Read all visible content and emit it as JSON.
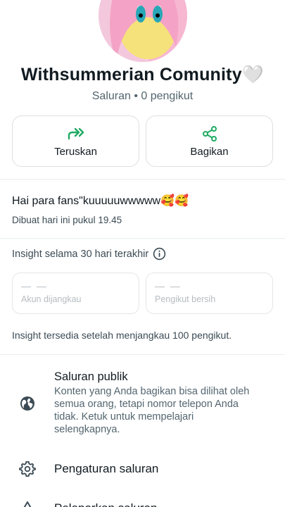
{
  "channel": {
    "name": "Withsummerian Comunity",
    "name_suffix": "🤍",
    "meta": "Saluran • 0 pengikut"
  },
  "actions": {
    "forward_label": "Teruskan",
    "share_label": "Bagikan"
  },
  "description": {
    "text": "Hai para fans\"kuuuuuwwwww🥰🥰",
    "created": "Dibuat hari ini pukul 19.45"
  },
  "insights": {
    "title": "Insight selama 30 hari terakhir",
    "reach": {
      "value": "— —",
      "label": "Akun dijangkau"
    },
    "net_followers": {
      "value": "— —",
      "label": "Pengikut bersih"
    },
    "note": "Insight tersedia setelah menjangkau 100 pengikut."
  },
  "settings": {
    "public_title": "Saluran publik",
    "public_desc": "Konten yang Anda bagikan bisa dilihat oleh semua orang, tetapi nomor telepon Anda tidak. Ketuk untuk mempelajari selengkapnya.",
    "channel_settings": "Pengaturan saluran",
    "next_item_partial": "Pelaporkan saluran"
  },
  "colors": {
    "accent": "#1daa61",
    "text_primary": "#111b21",
    "text_secondary": "#54656f",
    "border": "#dcdfe1"
  },
  "icons": {
    "forward": "forward-icon",
    "share": "share-icon",
    "info": "info-icon",
    "globe": "globe-icon",
    "settings": "gear-icon"
  }
}
